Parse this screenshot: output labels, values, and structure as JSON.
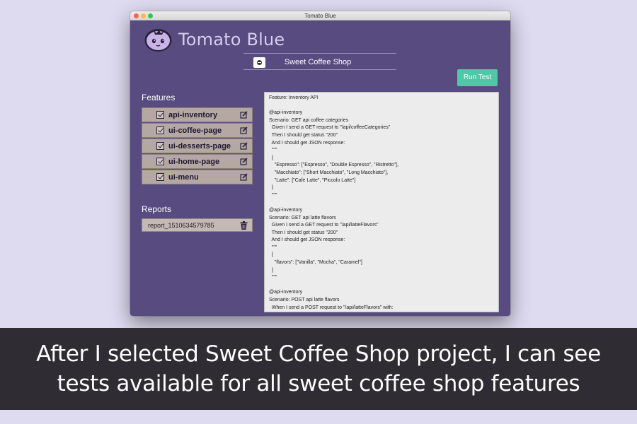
{
  "window": {
    "title": "Tomato Blue"
  },
  "app": {
    "name": "Tomato Blue",
    "logo_icon": "tomato-mascot-icon"
  },
  "project": {
    "selected": "Sweet Coffee Shop"
  },
  "toolbar": {
    "run_test_label": "Run Test"
  },
  "features": {
    "title": "Features",
    "items": [
      {
        "label": "api-inventory",
        "checked": true
      },
      {
        "label": "ui-coffee-page",
        "checked": true
      },
      {
        "label": "ui-desserts-page",
        "checked": true
      },
      {
        "label": "ui-home-page",
        "checked": true
      },
      {
        "label": "ui-menu",
        "checked": true
      }
    ]
  },
  "reports": {
    "title": "Reports",
    "items": [
      {
        "label": "report_1510634579785"
      }
    ]
  },
  "editor": {
    "content": "Feature: Inventory API\n\n@api-inventory\nScenario: GET api coffee categories\n  Given I send a GET request to \"/api/coffeeCategories\"\n  Then I should get status \"200\"\n  And I should get JSON response:\n  \"\"\"\n  {\n    \"Espresso\": [\"Espresso\", \"Double Espresso\", \"Ristretto\"],\n    \"Macchiato\": [\"Short Macchiato\", \"Long Macchiato\"],\n    \"Latte\": [\"Cafe Latte\", \"Piccolo Latte\"]\n  }\n  \"\"\"\n\n@api-inventory\nScenario: GET api latte flavors\n  Given I send a GET request to \"/api/latteFlavors\"\n  Then I should get status \"200\"\n  And I should get JSON response:\n  \"\"\"\n  {\n    \"flavors\": [\"Vanilla\", \"Mocha\", \"Caramel\"]\n  }\n  \"\"\"\n\n@api-inventory\nScenario: POST api latte flavors\n  When I send a POST request to \"/api/latteFlavors\" with:"
  },
  "caption": {
    "text": "After I selected Sweet Coffee Shop project, I can see tests available for all sweet coffee shop features"
  },
  "colors": {
    "window_bg": "#574b80",
    "accent_run": "#4ec8a6",
    "feature_bg": "#b5a7a1",
    "page_bg": "#dedbf0",
    "caption_bg": "#2f2d33"
  }
}
